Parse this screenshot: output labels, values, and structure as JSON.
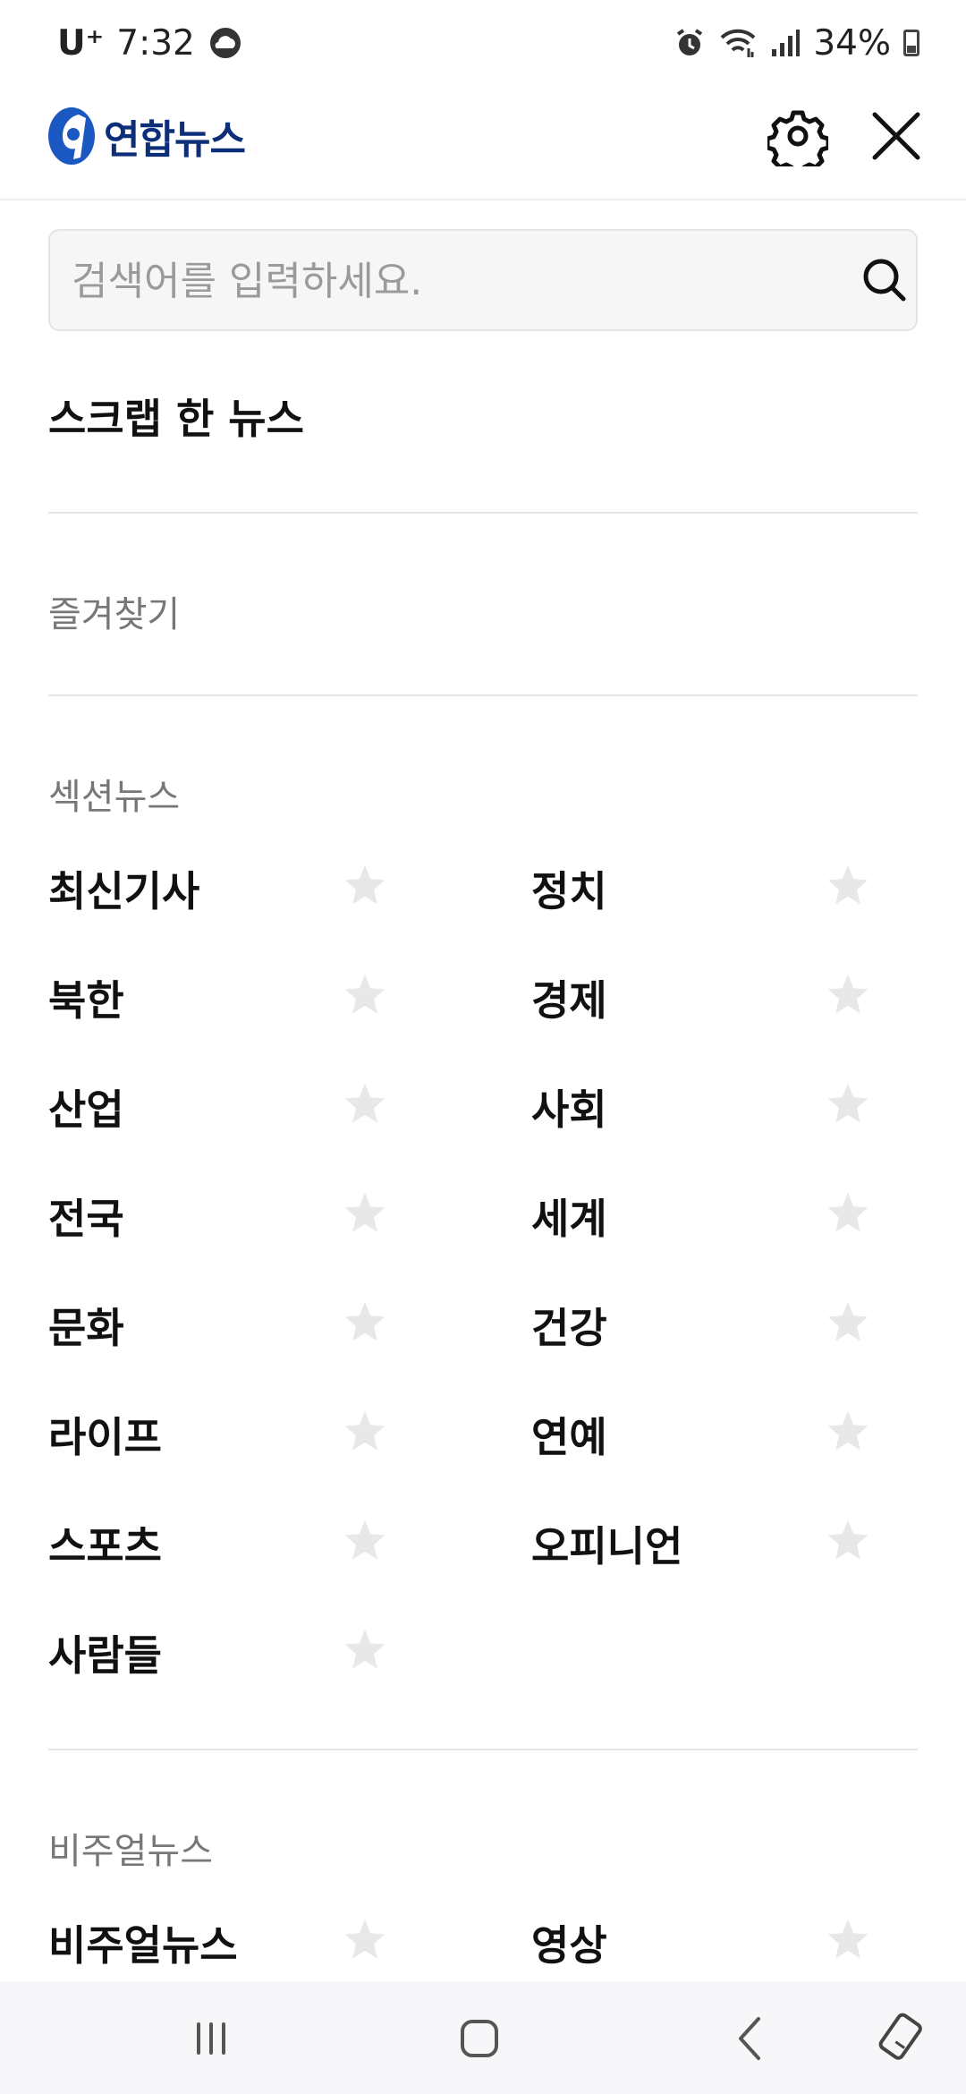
{
  "status_bar": {
    "carrier": "U⁺",
    "time": "7:32",
    "battery": "34%"
  },
  "header": {
    "app_name": "연합뉴스",
    "settings_icon": "gear-icon",
    "close_icon": "close-icon"
  },
  "search": {
    "placeholder": "검색어를 입력하세요.",
    "icon": "search-icon"
  },
  "scrap": {
    "label": "스크랩 한 뉴스"
  },
  "favorites": {
    "title": "즐겨찾기"
  },
  "section_news": {
    "title": "섹션뉴스",
    "items": [
      {
        "label": "최신기사"
      },
      {
        "label": "정치"
      },
      {
        "label": "북한"
      },
      {
        "label": "경제"
      },
      {
        "label": "산업"
      },
      {
        "label": "사회"
      },
      {
        "label": "전국"
      },
      {
        "label": "세계"
      },
      {
        "label": "문화"
      },
      {
        "label": "건강"
      },
      {
        "label": "라이프"
      },
      {
        "label": "연예"
      },
      {
        "label": "스포츠"
      },
      {
        "label": "오피니언"
      },
      {
        "label": "사람들"
      }
    ]
  },
  "visual_news": {
    "title": "비주얼뉴스",
    "items": [
      {
        "label": "비주얼뉴스"
      },
      {
        "label": "영상"
      }
    ]
  },
  "colors": {
    "brand": "#0d2f7a",
    "star_inactive": "#e8e8e8"
  }
}
